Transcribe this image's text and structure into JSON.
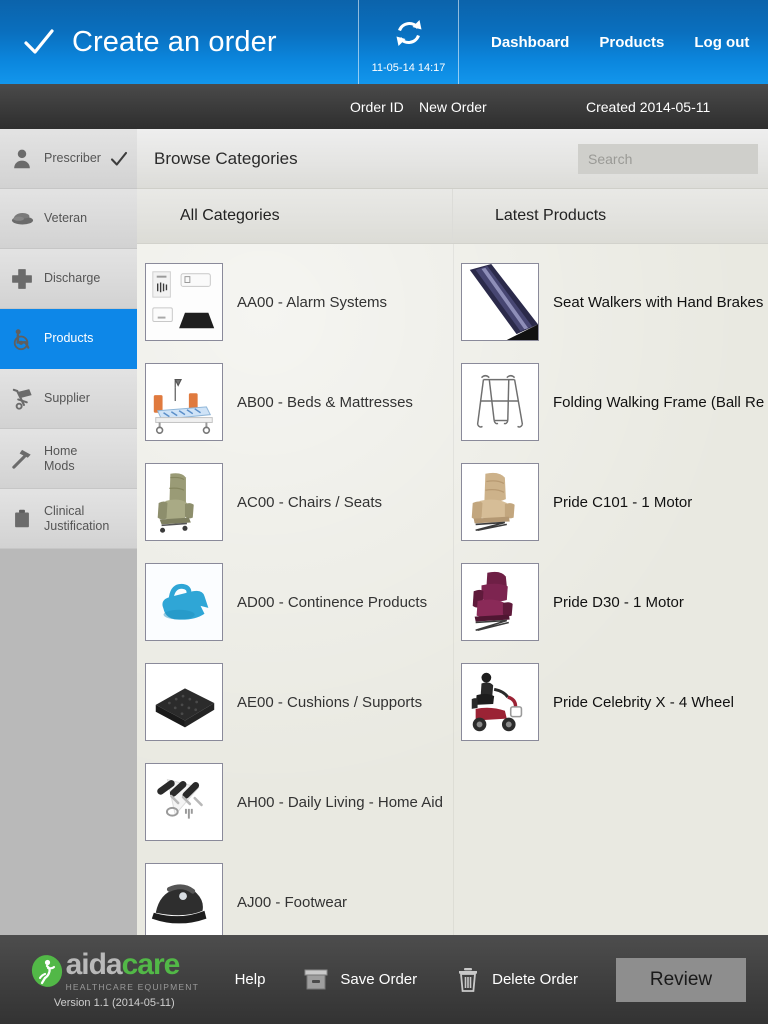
{
  "header": {
    "check_icon": "check-icon",
    "title": "Create an order",
    "sync_icon": "sync-refresh-icon",
    "sync_timestamp": "11-05-14 14:17",
    "nav": [
      {
        "label": "Dashboard",
        "name": "nav-dashboard"
      },
      {
        "label": "Products",
        "name": "nav-products"
      },
      {
        "label": "Log out",
        "name": "nav-logout"
      }
    ],
    "accent_blue": "#0b86dd"
  },
  "subbar": {
    "order_id_label": "Order ID",
    "order_id_value": "New Order",
    "created": "Created 2014-05-11"
  },
  "sidebar": {
    "active_color": "#0d87e8",
    "items": [
      {
        "label": "Prescriber",
        "icon": "person-icon",
        "active": false,
        "completed": true
      },
      {
        "label": "Veteran",
        "icon": "beret-hat-icon",
        "active": false,
        "completed": false
      },
      {
        "label": "Discharge",
        "icon": "medical-cross-icon",
        "active": false,
        "completed": false
      },
      {
        "label": "Products",
        "icon": "wheelchair-icon",
        "active": true,
        "completed": false
      },
      {
        "label": "Supplier",
        "icon": "hand-truck-icon",
        "active": false,
        "completed": false
      },
      {
        "label": "Home\nMods",
        "icon": "hammer-icon",
        "active": false,
        "completed": false
      },
      {
        "label": "Clinical\nJustification",
        "icon": "clipboard-icon",
        "active": false,
        "completed": false
      }
    ]
  },
  "main": {
    "browse_title": "Browse Categories",
    "search": {
      "placeholder": "Search",
      "value": "",
      "icon": "magnifier-icon"
    },
    "columns": {
      "left_header": "All Categories",
      "right_header": "Latest Products"
    },
    "categories": [
      {
        "label": "AA00 - Alarm Systems",
        "thumb": "alarm-systems-thumb"
      },
      {
        "label": "AB00 - Beds & Mattresses",
        "thumb": "hospital-bed-thumb"
      },
      {
        "label": "AC00 - Chairs / Seats",
        "thumb": "lift-chair-thumb"
      },
      {
        "label": "AD00 - Continence Products",
        "thumb": "urinal-bottle-thumb"
      },
      {
        "label": "AE00 - Cushions / Supports",
        "thumb": "cushion-thumb"
      },
      {
        "label": "AH00 - Daily Living - Home Aid",
        "thumb": "cutlery-aid-thumb"
      },
      {
        "label": "AJ00 - Footwear",
        "thumb": "medical-shoe-thumb"
      }
    ],
    "latest_products": [
      {
        "label": "Seat Walkers with Hand Brakes",
        "thumb": "walker-tube-thumb"
      },
      {
        "label": "Folding Walking Frame (Ball Re",
        "thumb": "walking-frame-thumb"
      },
      {
        "label": "Pride C101 - 1 Motor",
        "thumb": "tan-lift-chair-thumb"
      },
      {
        "label": "Pride D30 - 1 Motor",
        "thumb": "maroon-lift-chair-thumb"
      },
      {
        "label": "Pride Celebrity X - 4 Wheel",
        "thumb": "mobility-scooter-thumb"
      }
    ]
  },
  "footer": {
    "logo": {
      "leaf_icon": "aidacare-leaf-logo",
      "word_gray": "aida",
      "word_green": "care",
      "tagline": "HEALTHCARE EQUIPMENT",
      "green": "#52b847"
    },
    "version": "Version 1.1 (2014-05-11)",
    "actions": [
      {
        "label": "Help",
        "icon": null,
        "name": "help-button"
      },
      {
        "label": "Save Order",
        "icon": "save-box-icon",
        "name": "save-order-button"
      },
      {
        "label": "Delete Order",
        "icon": "trash-icon",
        "name": "delete-order-button"
      }
    ],
    "review_label": "Review"
  }
}
